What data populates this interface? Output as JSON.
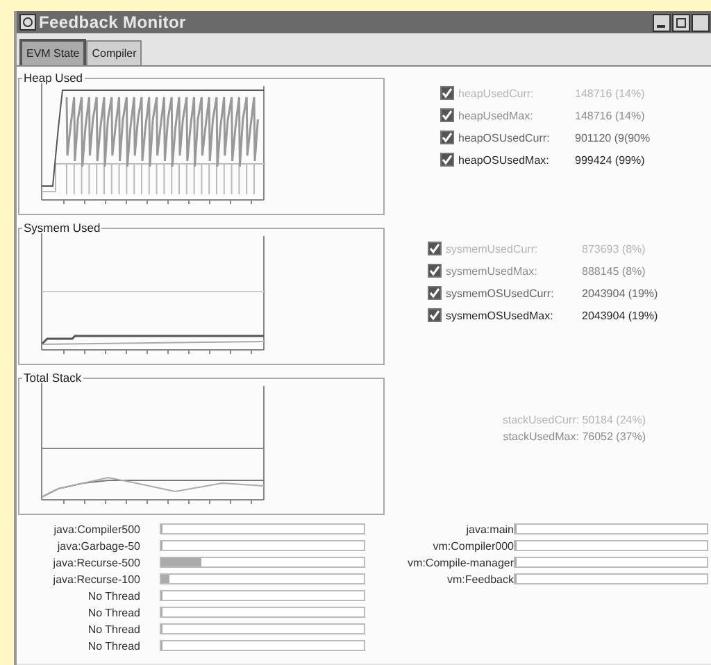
{
  "window": {
    "title": "Feedback Monitor"
  },
  "tabs": [
    {
      "label": "EVM State",
      "selected": true
    },
    {
      "label": "Compiler",
      "selected": false
    }
  ],
  "panels": [
    {
      "title": "Heap Used",
      "kind": "heap",
      "legend": [
        {
          "label": "heapUsedCurr:",
          "value": "148716 (14%)",
          "checked": true,
          "color": "#b4b4b4"
        },
        {
          "label": "heapUsedMax:",
          "value": "148716 (14%)",
          "checked": true,
          "color": "#8c8c8c"
        },
        {
          "label": "heapOSUsedCurr:",
          "value": "901120 (9(90%",
          "checked": true,
          "color": "#646464"
        },
        {
          "label": "heapOSUsedMax:",
          "value": "999424 (99%)",
          "checked": true,
          "color": "#282828"
        }
      ]
    },
    {
      "title": "Sysmem Used",
      "kind": "sysmem",
      "legend": [
        {
          "label": "sysmemUsedCurr:",
          "value": "873693  (8%)",
          "checked": true,
          "color": "#b4b4b4"
        },
        {
          "label": "sysmemUsedMax:",
          "value": "888145  (8%)",
          "checked": true,
          "color": "#8c8c8c"
        },
        {
          "label": "sysmemOSUsedCurr:",
          "value": "2043904 (19%)",
          "checked": true,
          "color": "#646464"
        },
        {
          "label": "sysmemOSUsedMax:",
          "value": "2043904 (19%)",
          "checked": true,
          "color": "#282828"
        }
      ]
    },
    {
      "title": "Total Stack",
      "kind": "stack",
      "readings": [
        {
          "text": "stackUsedCurr: 50184 (24%)",
          "color": "#b4b4b4"
        },
        {
          "text": "stackUsedMax: 76052 (37%)",
          "color": "#8c8c8c"
        }
      ]
    }
  ],
  "threads_left": [
    {
      "name": "java:Compiler500",
      "level": 0.01
    },
    {
      "name": "java:Garbage-50",
      "level": 0.01
    },
    {
      "name": "java:Recurse-500",
      "level": 0.2
    },
    {
      "name": "java:Recurse-100",
      "level": 0.04
    },
    {
      "name": "No Thread",
      "level": 0
    },
    {
      "name": "No Thread",
      "level": 0
    },
    {
      "name": "No Thread",
      "level": 0
    },
    {
      "name": "No Thread",
      "level": 0
    }
  ],
  "threads_right": [
    {
      "name": "java:main",
      "level": 0.01
    },
    {
      "name": "vm:Compiler000",
      "level": 0
    },
    {
      "name": "vm:Compile-manager",
      "level": 0
    },
    {
      "name": "vm:Feedback",
      "level": 0
    }
  ]
}
